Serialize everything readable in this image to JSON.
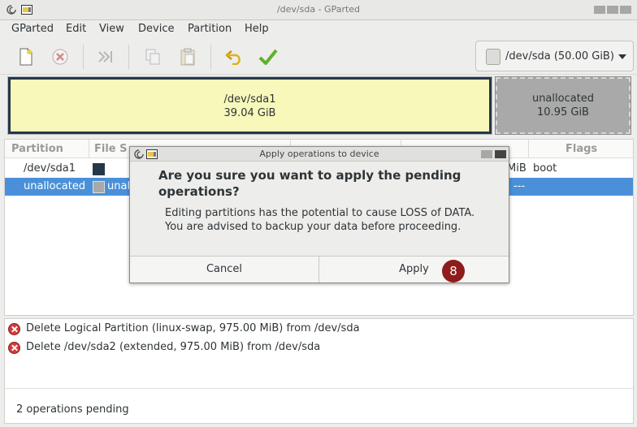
{
  "window": {
    "title": "/dev/sda - GParted"
  },
  "menu": [
    "GParted",
    "Edit",
    "View",
    "Device",
    "Partition",
    "Help"
  ],
  "toolbar": {
    "buttons": [
      "new-partition",
      "delete-partition",
      "resize-move",
      "copy",
      "paste",
      "undo",
      "apply"
    ],
    "device_selector": "/dev/sda (50.00 GiB)"
  },
  "partition_map": {
    "sda1": {
      "name": "/dev/sda1",
      "size": "39.04 GiB"
    },
    "unallocated": {
      "name": "unallocated",
      "size": "10.95 GiB"
    }
  },
  "table": {
    "headers": [
      "Partition",
      "File S",
      "Flags"
    ],
    "rows": [
      {
        "partition": "/dev/sda1",
        "fs_tail": "MiB",
        "flags": "boot",
        "fs_color": "#26374a"
      },
      {
        "partition": "unallocated",
        "fs_label": "unal",
        "flags": "---",
        "fs_color": "#a9a9a9"
      }
    ]
  },
  "operations": [
    "Delete Logical Partition (linux-swap, 975.00 MiB) from /dev/sda",
    "Delete /dev/sda2 (extended, 975.00 MiB) from /dev/sda"
  ],
  "status": "2 operations pending",
  "dialog": {
    "title": "Apply operations to device",
    "heading": "Are you sure you want to apply the pending operations?",
    "body_line1": "Editing partitions has the potential to cause LOSS of DATA.",
    "body_line2": "You are advised to backup your data before proceeding.",
    "cancel_label": "Cancel",
    "apply_label": "Apply",
    "badge": "8"
  },
  "colors": {
    "selection": "#4a90d9",
    "sda1_fill": "#f8f8ba",
    "unallocated_fill": "#a9a9a9",
    "badge": "#8f1b1b"
  }
}
